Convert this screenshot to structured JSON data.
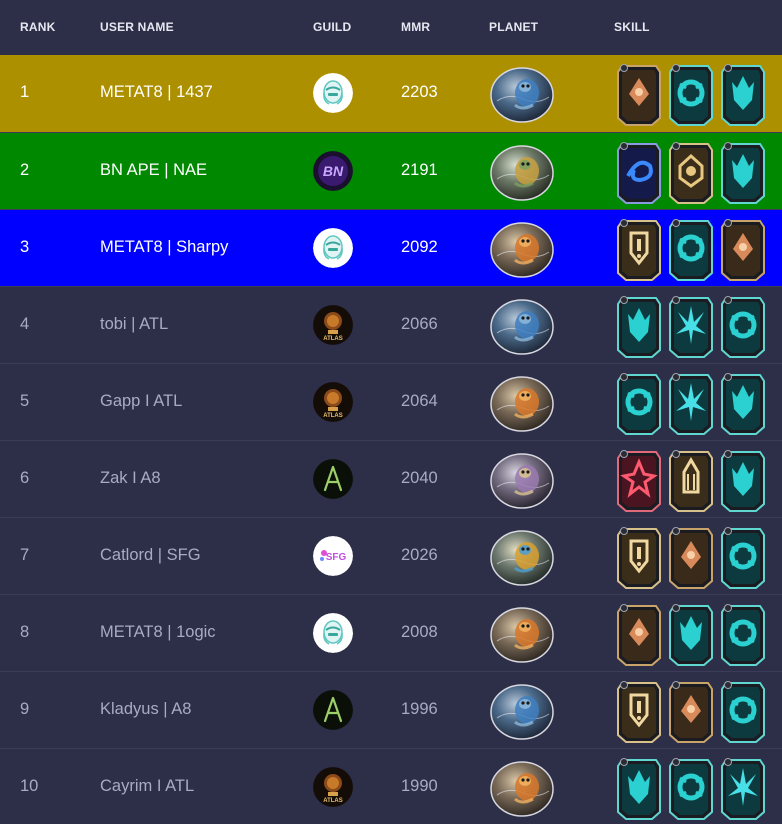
{
  "header": {
    "rank": "RANK",
    "user_name": "USER NAME",
    "guild": "GUILD",
    "mmr": "MMR",
    "planet": "PLANET",
    "skill": "SKILL"
  },
  "colors": {
    "background": "#2d2e48",
    "rank1": "#ad9000",
    "rank2": "#008800",
    "rank3": "#0000ff",
    "row_text_muted": "#a9abc4"
  },
  "rows": [
    {
      "rank": "1",
      "name": "METAT8 | 1437",
      "mmr": "2203",
      "guild_icon": "metat8-logo-icon",
      "planet_icon": "blue-planet-icon",
      "skills": [
        "bronze-orange-skill-icon",
        "teal-ring-skill-icon",
        "teal-flame-skill-icon"
      ]
    },
    {
      "rank": "2",
      "name": "BN APE | NAE",
      "mmr": "2191",
      "guild_icon": "bn-logo-icon",
      "planet_icon": "green-planet-icon",
      "skills": [
        "purple-swirl-skill-icon",
        "gold-gem-skill-icon",
        "teal-flame-skill-icon"
      ]
    },
    {
      "rank": "3",
      "name": "METAT8 | Sharpy",
      "mmr": "2092",
      "guild_icon": "metat8-logo-icon",
      "planet_icon": "orange-planet-icon",
      "skills": [
        "gold-shield-skill-icon",
        "teal-ring-skill-icon",
        "bronze-orange-skill-icon"
      ]
    },
    {
      "rank": "4",
      "name": "tobi | ATL",
      "mmr": "2066",
      "guild_icon": "atlas-logo-icon",
      "planet_icon": "blue-planet-icon",
      "skills": [
        "teal-flame-skill-icon",
        "teal-burst-skill-icon",
        "teal-ring-skill-icon"
      ]
    },
    {
      "rank": "5",
      "name": "Gapp I ATL",
      "mmr": "2064",
      "guild_icon": "atlas-logo-icon",
      "planet_icon": "orange-planet-icon",
      "skills": [
        "teal-ring-skill-icon",
        "teal-burst-skill-icon",
        "teal-flame-skill-icon"
      ]
    },
    {
      "rank": "6",
      "name": "Zak I A8",
      "mmr": "2040",
      "guild_icon": "a8-logo-icon",
      "planet_icon": "purple-planet-icon",
      "skills": [
        "red-cross-skill-icon",
        "gold-spire-skill-icon",
        "teal-flame-skill-icon"
      ]
    },
    {
      "rank": "7",
      "name": "Catlord | SFG",
      "mmr": "2026",
      "guild_icon": "sfg-logo-icon",
      "planet_icon": "gold-planet-icon",
      "skills": [
        "gold-shield-skill-icon",
        "bronze-orange-skill-icon",
        "teal-ring-skill-icon"
      ]
    },
    {
      "rank": "8",
      "name": "METAT8 | 1ogic",
      "mmr": "2008",
      "guild_icon": "metat8-logo-icon",
      "planet_icon": "orange-planet-icon",
      "skills": [
        "bronze-orange-skill-icon",
        "teal-flame-skill-icon",
        "teal-ring-skill-icon"
      ]
    },
    {
      "rank": "9",
      "name": "Kladyus | A8",
      "mmr": "1996",
      "guild_icon": "a8-logo-icon",
      "planet_icon": "blue-planet-icon",
      "skills": [
        "gold-shield-skill-icon",
        "bronze-orange-skill-icon",
        "teal-ring-skill-icon"
      ]
    },
    {
      "rank": "10",
      "name": "Cayrim I ATL",
      "mmr": "1990",
      "guild_icon": "atlas-logo-icon",
      "planet_icon": "orange-planet-icon",
      "skills": [
        "teal-flame-skill-icon",
        "teal-ring-skill-icon",
        "teal-burst-skill-icon"
      ]
    }
  ],
  "guild_logos": {
    "sfg_text": "SFG",
    "atlas_text": "ATLAS",
    "bn_text": "BN"
  }
}
